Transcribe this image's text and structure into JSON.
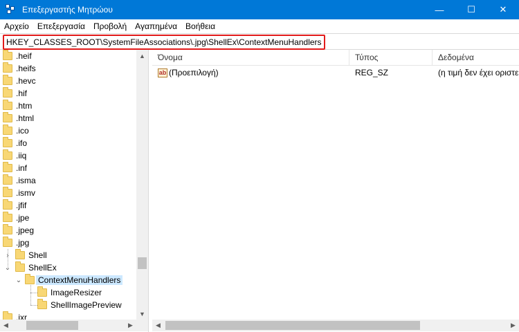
{
  "window": {
    "title": "Επεξεργαστής Μητρώου",
    "minimize": "—",
    "maximize": "☐",
    "close": "✕"
  },
  "menu": [
    "Αρχείο",
    "Επεξεργασία",
    "Προβολή",
    "Αγαπημένα",
    "Βοήθεια"
  ],
  "address": "HKEY_CLASSES_ROOT\\SystemFileAssociations\\.jpg\\ShellEx\\ContextMenuHandlers",
  "tree": {
    "items": [
      ".heif",
      ".heifs",
      ".hevc",
      ".hif",
      ".htm",
      ".html",
      ".ico",
      ".ifo",
      ".iiq",
      ".inf",
      ".isma",
      ".ismv",
      ".jfif",
      ".jpe",
      ".jpeg",
      ".jpg",
      "Shell",
      "ShellEx",
      "ContextMenuHandlers",
      "ImageResizer",
      "ShellImagePreview",
      ".jxr"
    ],
    "chevron_collapsed": "›",
    "chevron_expanded": "⌄"
  },
  "list": {
    "columns": [
      "Όνομα",
      "Τύπος",
      "Δεδομένα"
    ],
    "rows": [
      {
        "name": "(Προεπιλογή)",
        "type": "REG_SZ",
        "data": "(η τιμή δεν έχει οριστεί)",
        "icon": "ab"
      }
    ]
  },
  "scroll": {
    "up": "▲",
    "down": "▼",
    "left": "◀",
    "right": "▶"
  },
  "colors": {
    "titlebar": "#0078d7",
    "highlight_border": "#e21a1a",
    "selection": "#cce8ff",
    "folder": "#f8d775"
  }
}
